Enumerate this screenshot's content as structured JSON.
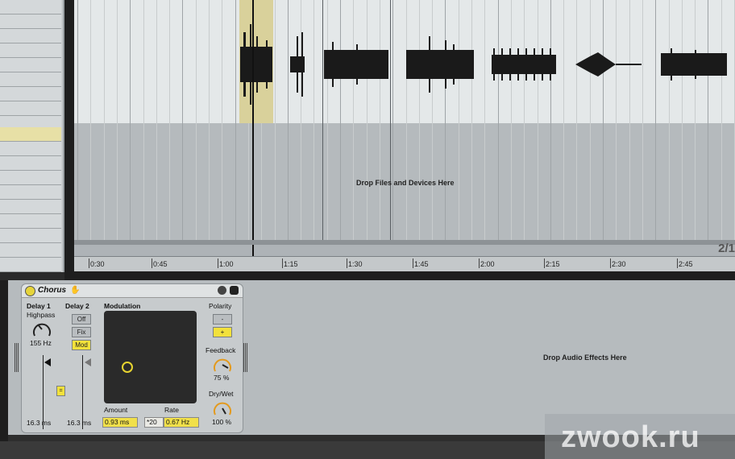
{
  "arrangement": {
    "drop_files_text": "Drop Files and Devices Here",
    "page_number": "2/1",
    "ruler_labels": [
      "0:30",
      "0:45",
      "1:00",
      "1:15",
      "1:30",
      "1:45",
      "2:00",
      "2:15",
      "2:30",
      "2:45"
    ]
  },
  "device": {
    "title": "Chorus",
    "delay1_label": "Delay 1",
    "highpass_label": "Highpass",
    "highpass_value": "155 Hz",
    "delay1_time": "16.3 ms",
    "delay2_label": "Delay 2",
    "delay2_off": "Off",
    "delay2_fix": "Fix",
    "delay2_mod": "Mod",
    "delay2_time": "16.3 ms",
    "modulation_label": "Modulation",
    "amount_label": "Amount",
    "amount_value": "0.93 ms",
    "rate_label": "Rate",
    "rate_mult": "*20",
    "rate_value": "0.67 Hz",
    "polarity_label": "Polarity",
    "polarity_minus": "-",
    "polarity_plus": "+",
    "feedback_label": "Feedback",
    "feedback_value": "75 %",
    "drywet_label": "Dry/Wet",
    "drywet_value": "100 %"
  },
  "device_chain": {
    "drop_effects_text": "Drop Audio Effects Here"
  },
  "watermark": "zwook.ru",
  "colors": {
    "accent_yellow": "#f2e13b",
    "clip_loop": "#d9d19b",
    "panel_gray": "#c7cbcd"
  }
}
